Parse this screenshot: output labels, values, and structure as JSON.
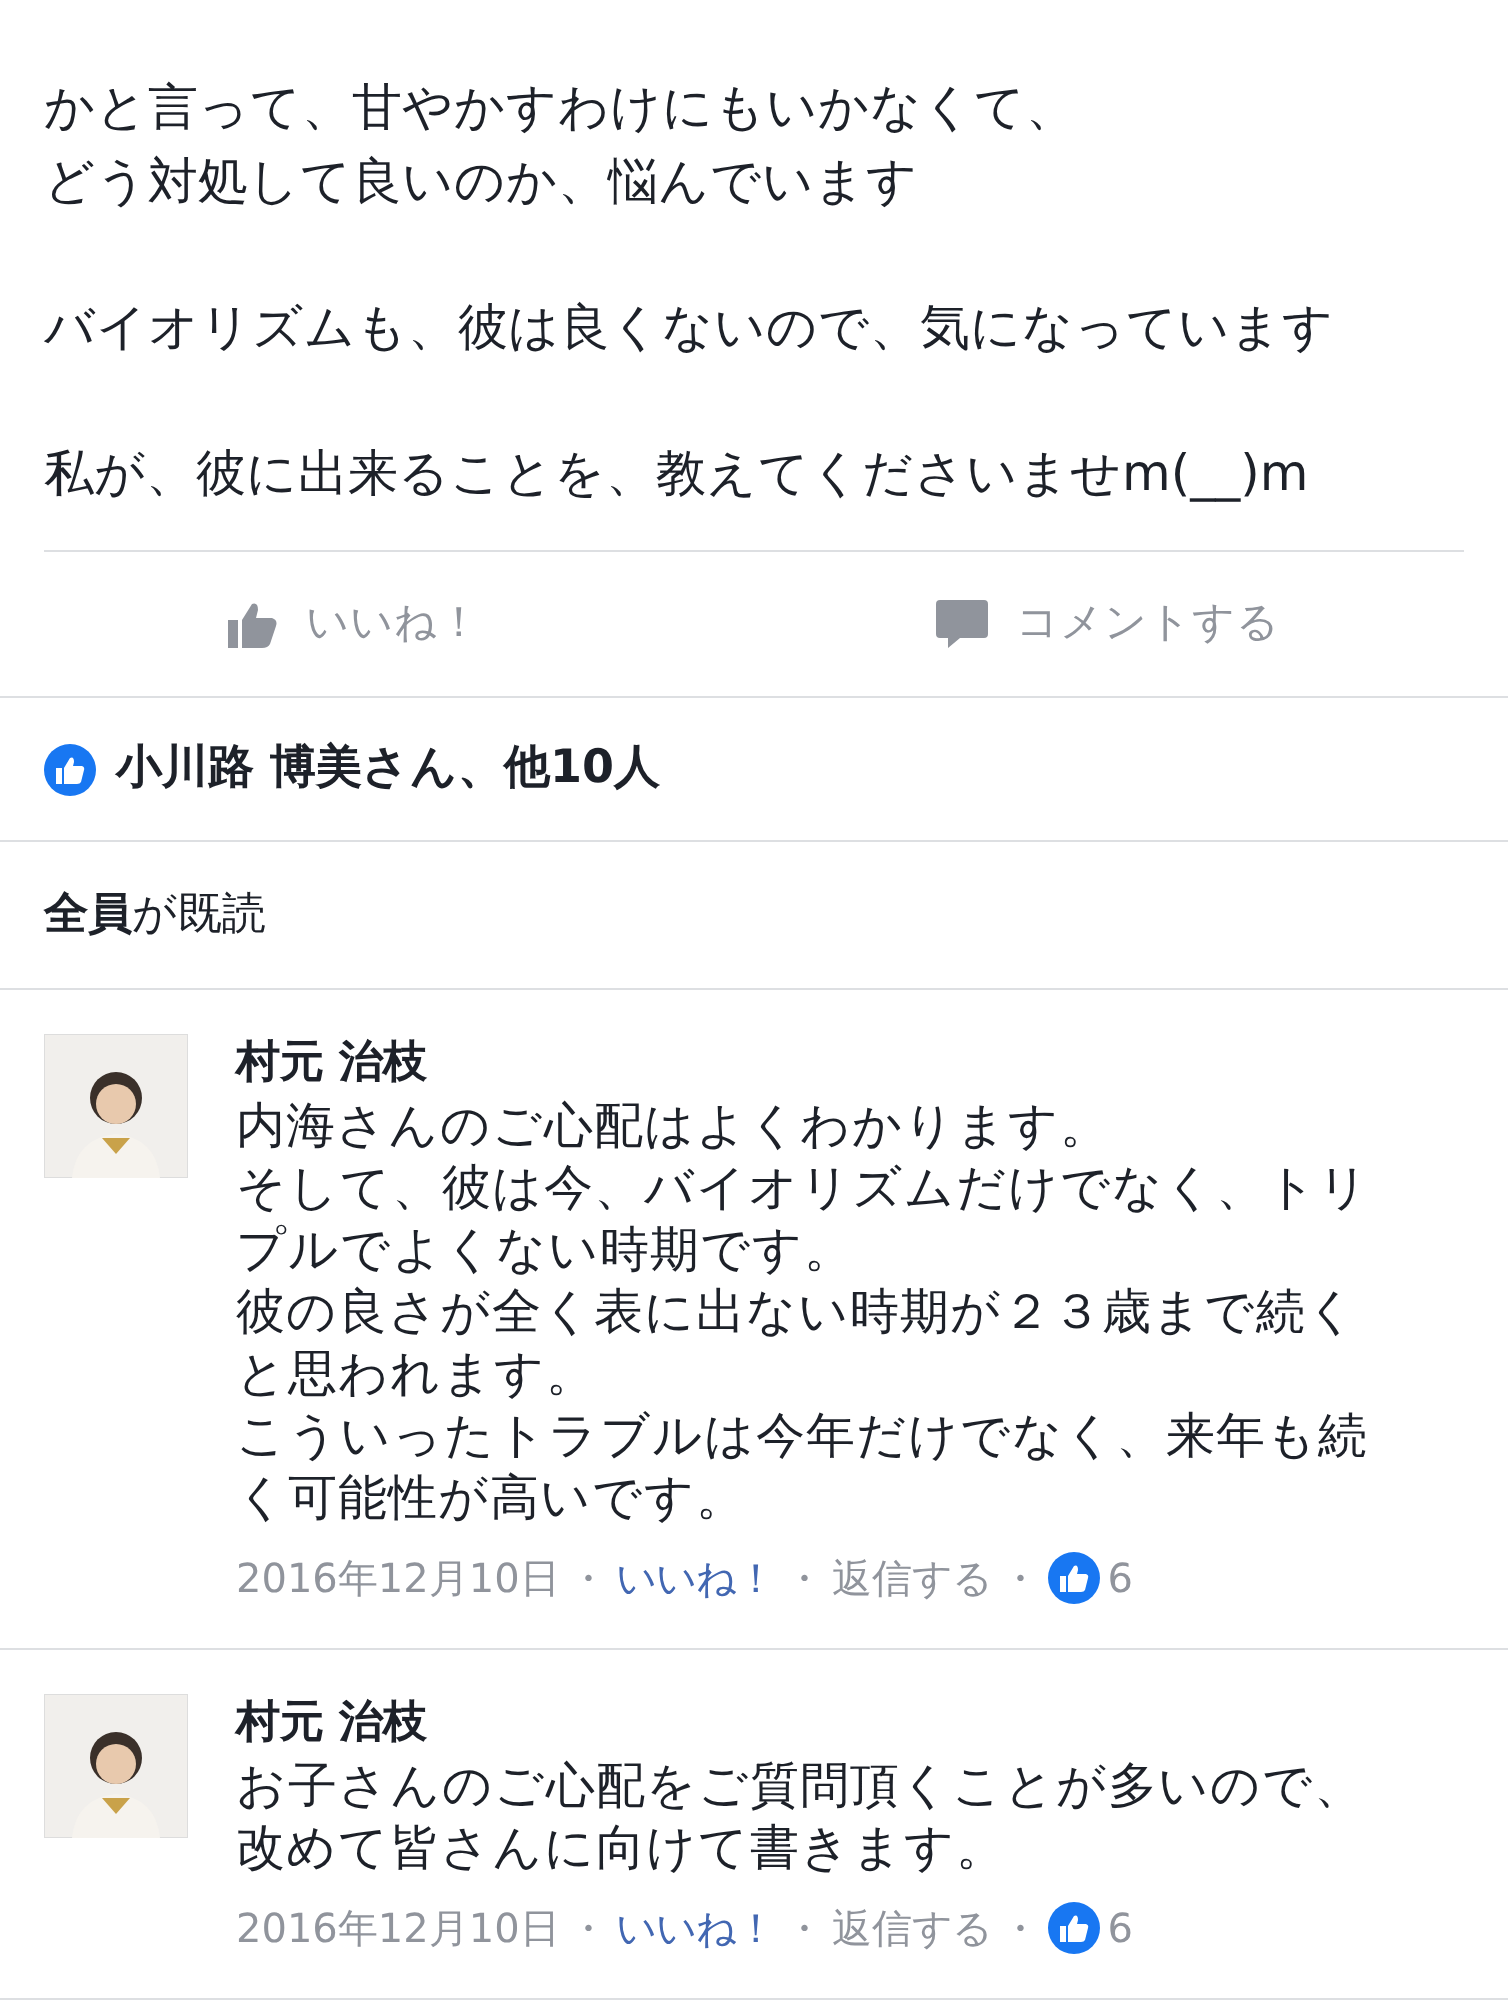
{
  "post": {
    "paragraphs": [
      [
        "かと言って、甘やかすわけにもいかなくて、",
        "どう対処して良いのか、悩んでいます"
      ],
      [
        "バイオリズムも、彼は良くないので、気になっています"
      ],
      [
        "私が、彼に出来ることを、教えてくださいませm(__)m"
      ]
    ]
  },
  "actions": [
    {
      "kind": "like",
      "label": "いいね！"
    },
    {
      "kind": "comment",
      "label": "コメントする"
    }
  ],
  "likes": {
    "text": "小川路 博美さん、他10人"
  },
  "seen": {
    "text": "**全員**が既読"
  },
  "comments": [
    {
      "author": "村元 治枝",
      "lines": [
        "内海さんのご心配はよくわかります。",
        "そして、彼は今、バイオリズムだけでなく、トリ",
        "プルでよくない時期です。",
        "彼の良さが全く表に出ない時期が２３歳まで続く",
        "と思われます。",
        "こういったトラブルは今年だけでなく、来年も続",
        "く可能性が高いです。"
      ],
      "date": "2016年12月10日",
      "separator": "・",
      "like_label": "いいね！",
      "reply_label": "返信する",
      "like_count": "6"
    },
    {
      "author": "村元 治枝",
      "lines": [
        "お子さんのご心配をご質問頂くことが多いので、",
        "改めて皆さんに向けて書きます。"
      ],
      "date": "2016年12月10日",
      "separator": "・",
      "like_label": "いいね！",
      "reply_label": "返信する",
      "like_count": "6"
    }
  ]
}
